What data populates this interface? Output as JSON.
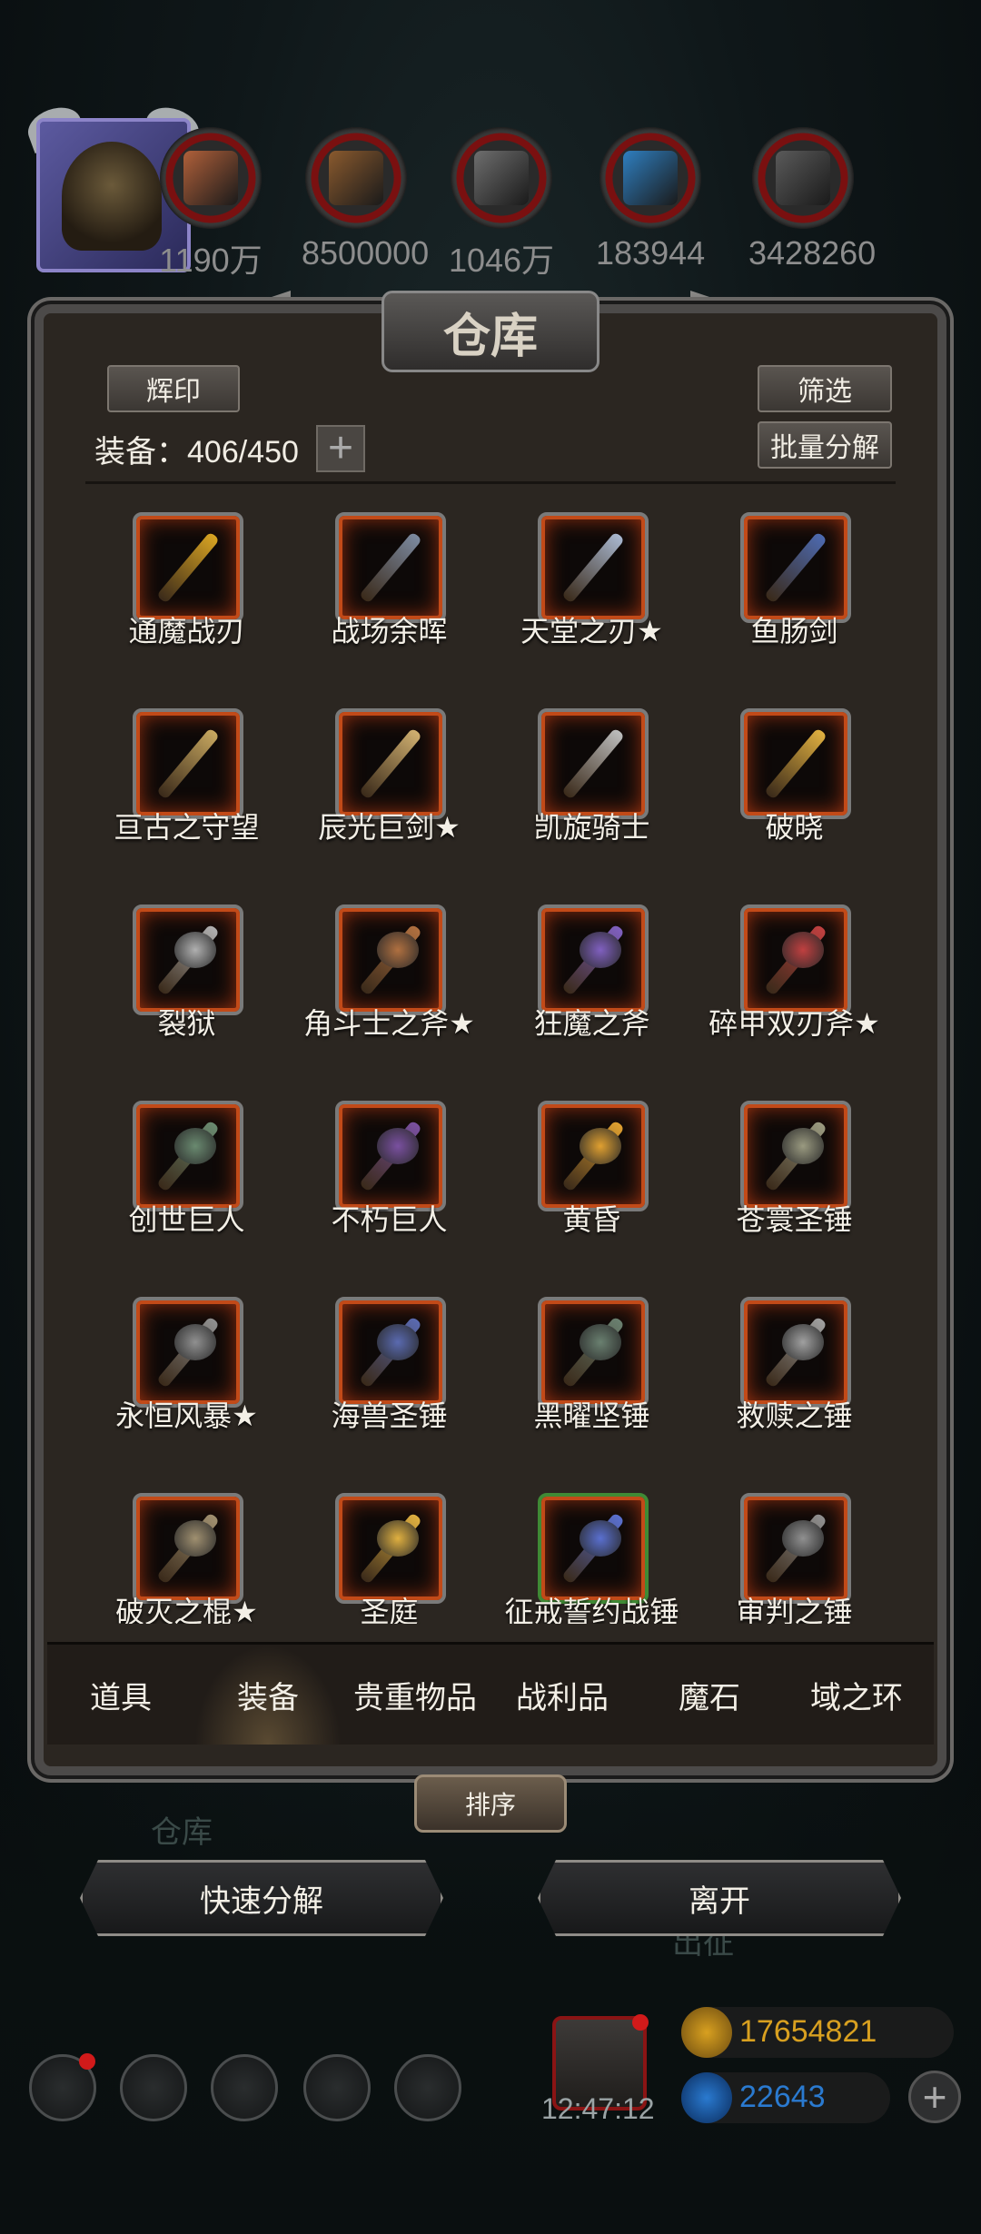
{
  "resources": [
    {
      "icon": "ore-icon",
      "value": "1190万",
      "color": "#b0603a"
    },
    {
      "icon": "wood-icon",
      "value": "8500000",
      "color": "#8a5a2e"
    },
    {
      "icon": "iron-icon",
      "value": "1046万",
      "color": "#6e6e6e"
    },
    {
      "icon": "crystal-icon",
      "value": "183944",
      "color": "#2f7fc0"
    },
    {
      "icon": "stone-icon",
      "value": "3428260",
      "color": "#5a5a5a"
    }
  ],
  "panel": {
    "title": "仓库",
    "emblem_button": "辉印",
    "filter_button": "筛选",
    "batch_button": "批量分解",
    "count_label": "装备：406/450"
  },
  "items": [
    {
      "name": "通魔战刃",
      "color": "#d9a422"
    },
    {
      "name": "战场余晖",
      "color": "#7c8aa0"
    },
    {
      "name": "天堂之刃★",
      "color": "#a9b8d0"
    },
    {
      "name": "鱼肠剑",
      "color": "#4d6ab0"
    },
    {
      "name": "亘古之守望",
      "color": "#c8a860"
    },
    {
      "name": "辰光巨剑★",
      "color": "#d0b070"
    },
    {
      "name": "凯旋骑士",
      "color": "#bdbdbd"
    },
    {
      "name": "破晓",
      "color": "#e0b040"
    },
    {
      "name": "裂狱",
      "color": "#b0b0b0"
    },
    {
      "name": "角斗士之斧★",
      "color": "#b07040"
    },
    {
      "name": "狂魔之斧",
      "color": "#8060c0"
    },
    {
      "name": "碎甲双刃斧★",
      "color": "#c04040"
    },
    {
      "name": "创世巨人",
      "color": "#6a8a70"
    },
    {
      "name": "不朽巨人",
      "color": "#7a50a0"
    },
    {
      "name": "黄昏",
      "color": "#e0a030"
    },
    {
      "name": "苍寰圣锤",
      "color": "#9a9a80"
    },
    {
      "name": "永恒风暴★",
      "color": "#909090"
    },
    {
      "name": "海兽圣锤",
      "color": "#5a6ab0"
    },
    {
      "name": "黑曜坚锤",
      "color": "#6a8070"
    },
    {
      "name": "救赎之锤",
      "color": "#a0a0a0"
    },
    {
      "name": "破灭之棍★",
      "color": "#a09070"
    },
    {
      "name": "圣庭",
      "color": "#e0b040"
    },
    {
      "name": "征戒誓约战锤",
      "color": "#5a70d0",
      "epic": true
    },
    {
      "name": "审判之锤",
      "color": "#909090"
    }
  ],
  "tabs": [
    {
      "label": "道具"
    },
    {
      "label": "装备",
      "active": true
    },
    {
      "label": "贵重物品"
    },
    {
      "label": "战利品"
    },
    {
      "label": "魔石"
    },
    {
      "label": "域之环"
    }
  ],
  "sort_button": "排序",
  "quick_decompose_button": "快速分解",
  "leave_button": "离开",
  "background_labels": {
    "left": "仓库",
    "right": "出征"
  },
  "bottom": {
    "timer": "12:47:12",
    "gold": "17654821",
    "gems": "22643",
    "gold_color": "#d8a020",
    "gem_color": "#2a7ad0"
  }
}
